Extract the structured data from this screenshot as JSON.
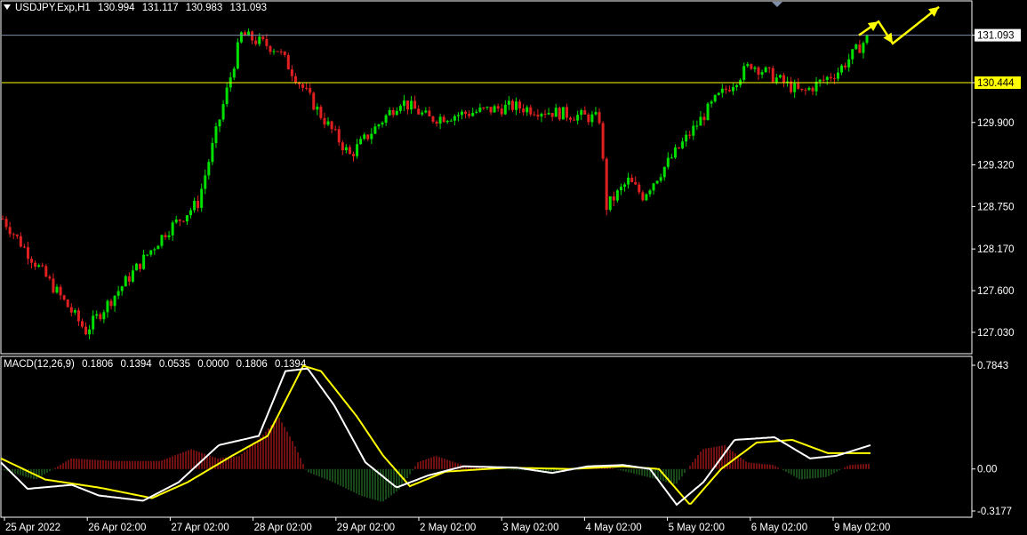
{
  "header": {
    "symbol": "USDJPY.Exp,H1",
    "open": "130.994",
    "high": "131.117",
    "low": "130.983",
    "close": "131.093"
  },
  "macd_header": {
    "label": "MACD(12,26,9)",
    "values": [
      "0.1806",
      "0.1394",
      "0.0535",
      "0.0000",
      "0.1806",
      "0.1394"
    ]
  },
  "colors": {
    "background": "#000000",
    "bull": "#00e000",
    "bear": "#e02020",
    "resistance": "#ffff00",
    "current_line": "#7f8faa",
    "macd_line": "#ffffff",
    "signal_line": "#ffff00",
    "arrow": "#ffff00"
  },
  "chart_data": [
    {
      "type": "candlestick",
      "title": "USDJPY.Exp,H1",
      "ylim": [
        126.75,
        131.55
      ],
      "y_ticks": [
        "131.093",
        "130.444",
        "129.900",
        "129.320",
        "128.750",
        "128.170",
        "127.600",
        "127.030"
      ],
      "x_ticks": [
        "25 Apr 2022",
        "26 Apr 02:00",
        "27 Apr 02:00",
        "28 Apr 02:00",
        "29 Apr 02:00",
        "2 May 02:00",
        "3 May 02:00",
        "4 May 02:00",
        "5 May 02:00",
        "6 May 02:00",
        "9 May 02:00"
      ],
      "current_price": 131.093,
      "resistance_level": 130.444,
      "forecast_path": [
        [
          0,
          131.093
        ],
        [
          22,
          131.28
        ],
        [
          38,
          130.98
        ],
        [
          90,
          131.48
        ]
      ],
      "segments": [
        {
          "bars": 24,
          "from": 128.65,
          "to": 127.05
        },
        {
          "bars": 22,
          "from": 127.05,
          "to": 128.4
        },
        {
          "bars": 9,
          "from": 128.4,
          "to": 128.8
        },
        {
          "bars": 12,
          "from": 128.8,
          "to": 131.1
        },
        {
          "bars": 10,
          "from": 131.1,
          "to": 130.9
        },
        {
          "bars": 12,
          "from": 130.9,
          "to": 130.0
        },
        {
          "bars": 8,
          "from": 130.0,
          "to": 129.45
        },
        {
          "bars": 14,
          "from": 129.45,
          "to": 130.2
        },
        {
          "bars": 8,
          "from": 130.2,
          "to": 129.95
        },
        {
          "bars": 23,
          "from": 129.95,
          "to": 130.12
        },
        {
          "bars": 24,
          "from": 130.12,
          "to": 129.95
        },
        {
          "bars": 2,
          "from": 129.95,
          "to": 128.75
        },
        {
          "bars": 6,
          "from": 128.75,
          "to": 129.1
        },
        {
          "bars": 4,
          "from": 129.1,
          "to": 128.9
        },
        {
          "bars": 20,
          "from": 128.9,
          "to": 130.2
        },
        {
          "bars": 10,
          "from": 130.2,
          "to": 130.7
        },
        {
          "bars": 14,
          "from": 130.7,
          "to": 130.3
        },
        {
          "bars": 10,
          "from": 130.3,
          "to": 130.6
        },
        {
          "bars": 8,
          "from": 130.6,
          "to": 131.05
        }
      ]
    },
    {
      "type": "macd",
      "title": "MACD(12,26,9)",
      "ylim": [
        -0.3177,
        0.7843
      ],
      "y_ticks": [
        "0.7843",
        "0.00",
        "-0.3177"
      ],
      "macd_points": [
        [
          0,
          0.05
        ],
        [
          30,
          -0.15
        ],
        [
          80,
          -0.12
        ],
        [
          110,
          -0.2
        ],
        [
          160,
          -0.24
        ],
        [
          200,
          -0.1
        ],
        [
          245,
          0.18
        ],
        [
          290,
          0.25
        ],
        [
          320,
          0.74
        ],
        [
          345,
          0.76
        ],
        [
          375,
          0.48
        ],
        [
          410,
          0.05
        ],
        [
          445,
          -0.14
        ],
        [
          480,
          -0.05
        ],
        [
          520,
          0.02
        ],
        [
          580,
          0.01
        ],
        [
          620,
          -0.03
        ],
        [
          660,
          0.02
        ],
        [
          700,
          0.03
        ],
        [
          730,
          0.0
        ],
        [
          760,
          -0.27
        ],
        [
          790,
          -0.1
        ],
        [
          825,
          0.22
        ],
        [
          870,
          0.24
        ],
        [
          910,
          0.08
        ],
        [
          940,
          0.1
        ],
        [
          978,
          0.18
        ]
      ],
      "signal_points": [
        [
          0,
          0.08
        ],
        [
          50,
          -0.08
        ],
        [
          110,
          -0.14
        ],
        [
          170,
          -0.22
        ],
        [
          210,
          -0.1
        ],
        [
          260,
          0.1
        ],
        [
          300,
          0.25
        ],
        [
          340,
          0.78
        ],
        [
          360,
          0.74
        ],
        [
          400,
          0.4
        ],
        [
          430,
          0.1
        ],
        [
          460,
          -0.13
        ],
        [
          500,
          -0.02
        ],
        [
          570,
          0.01
        ],
        [
          640,
          0.0
        ],
        [
          700,
          0.02
        ],
        [
          740,
          0.0
        ],
        [
          775,
          -0.27
        ],
        [
          810,
          0.0
        ],
        [
          850,
          0.2
        ],
        [
          890,
          0.22
        ],
        [
          930,
          0.12
        ],
        [
          978,
          0.12
        ]
      ],
      "histogram_points": [
        [
          0,
          0.0
        ],
        [
          40,
          -0.08
        ],
        [
          80,
          0.08
        ],
        [
          130,
          0.06
        ],
        [
          180,
          0.06
        ],
        [
          215,
          0.15
        ],
        [
          245,
          0.08
        ],
        [
          270,
          0.1
        ],
        [
          295,
          0.25
        ],
        [
          313,
          0.4
        ],
        [
          330,
          0.2
        ],
        [
          345,
          -0.02
        ],
        [
          375,
          -0.1
        ],
        [
          405,
          -0.2
        ],
        [
          430,
          -0.25
        ],
        [
          450,
          -0.15
        ],
        [
          470,
          0.05
        ],
        [
          490,
          0.1
        ],
        [
          520,
          0.03
        ],
        [
          560,
          0.0
        ],
        [
          620,
          -0.02
        ],
        [
          680,
          0.02
        ],
        [
          740,
          -0.08
        ],
        [
          760,
          -0.12
        ],
        [
          790,
          0.15
        ],
        [
          815,
          0.18
        ],
        [
          840,
          0.05
        ],
        [
          870,
          0.03
        ],
        [
          900,
          -0.08
        ],
        [
          930,
          -0.06
        ],
        [
          955,
          0.03
        ],
        [
          978,
          0.04
        ]
      ]
    }
  ]
}
